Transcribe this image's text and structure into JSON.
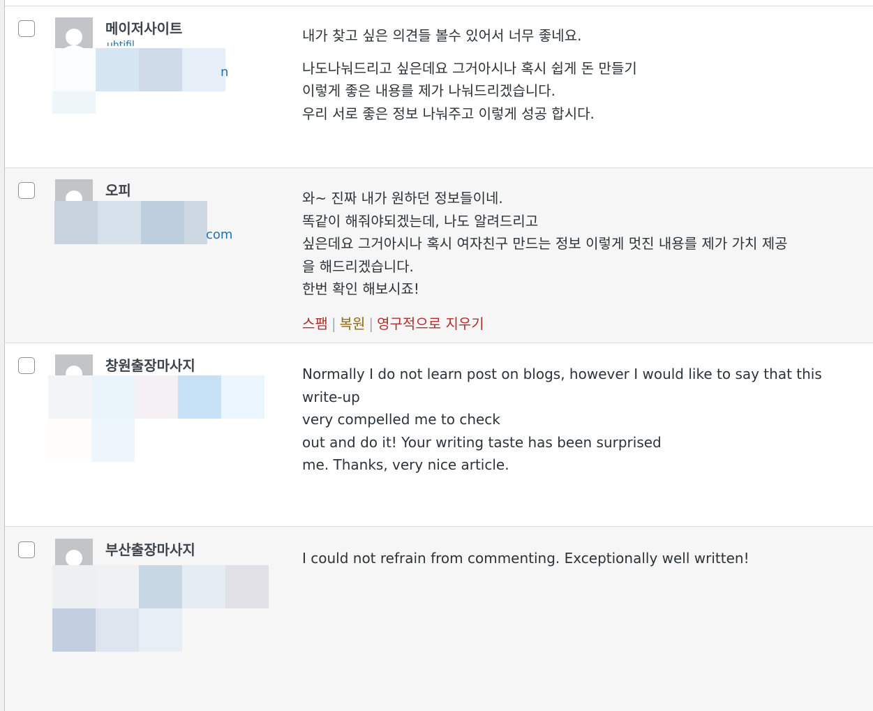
{
  "comments": [
    {
      "author": "메이저사이트",
      "url_fragment_top": "uhtifil",
      "url_suffix": "n",
      "paragraphs": [
        [
          "내가 찾고 싶은 의견들 볼수 있어서 너무 좋네요."
        ],
        [
          "나도나눠드리고 싶은데요 그거아시나 혹시 쉽게 돈 만들기",
          "이렇게 좋은 내용를 제가 나눠드리겠습니다.",
          "우리 서로 좋은 정보 나눠주고 이렇게 성공 합시다."
        ]
      ]
    },
    {
      "author": "오피",
      "url_suffix": "com",
      "paragraphs": [
        [
          "와~ 진짜 내가 원하던 정보들이네.",
          "똑같이 해줘야되겠는데, 나도 알려드리고",
          "싶은데요 그거아시나 혹시 여자친구 만드는 정보 이렇게 멋진 내용를 제가 가치 제공",
          "을 해드리겠습니다.",
          "한번 확인 해보시죠!"
        ]
      ],
      "actions": {
        "spam": "스팸",
        "restore": "복원",
        "delete": "영구적으로 지우기",
        "separator": "|"
      }
    },
    {
      "author": "창원출장마사지",
      "paragraphs": [
        [
          "Normally I do not learn post on blogs, however I would like to say that this write-up",
          "very compelled me to check",
          "out and do it! Your writing taste has been surprised",
          "me. Thanks, very nice article."
        ]
      ]
    },
    {
      "author": "부산출장마사지",
      "paragraphs": [
        [
          "I could not refrain from commenting. Exceptionally well written!"
        ]
      ]
    }
  ]
}
